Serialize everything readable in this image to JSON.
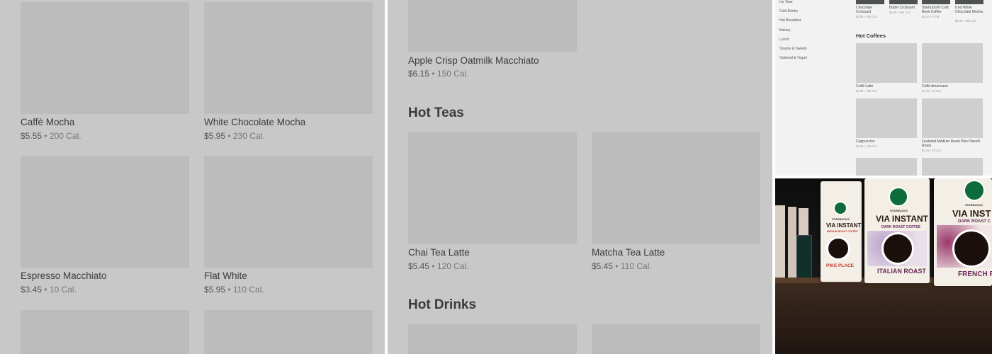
{
  "left_menu": {
    "items": [
      {
        "name": "Caffè Mocha",
        "price": "$5.55",
        "sep": " • ",
        "cal": "200 Cal."
      },
      {
        "name": "White Chocolate Mocha",
        "price": "$5.95",
        "sep": " • ",
        "cal": "230 Cal."
      },
      {
        "name": "Espresso Macchiato",
        "price": "$3.45",
        "sep": " • ",
        "cal": "10 Cal."
      },
      {
        "name": "Flat White",
        "price": "$5.95",
        "sep": " • ",
        "cal": "110 Cal."
      }
    ]
  },
  "middle_menu": {
    "top_item": {
      "name": "Apple Crisp Oatmilk Macchiato",
      "price": "$6.15",
      "sep": " • ",
      "cal": "150 Cal."
    },
    "hot_teas": {
      "title": "Hot Teas",
      "items": [
        {
          "name": "Chai Tea Latte",
          "price": "$5.45",
          "sep": " • ",
          "cal": "120 Cal."
        },
        {
          "name": "Matcha Tea Latte",
          "price": "$5.45",
          "sep": " • ",
          "cal": "110 Cal."
        }
      ]
    },
    "hot_drinks": {
      "title": "Hot Drinks"
    }
  },
  "mini_menu": {
    "nav": [
      "Ice Teas",
      "Cold Drinks",
      "Hot Breakfast",
      "Bakery",
      "Lunch",
      "Snacks & Sweets",
      "Oatmeal & Yogurt"
    ],
    "top_row": [
      {
        "name": "Chocolate Croissant",
        "meta": "$4.55 • 300 Cal."
      },
      {
        "name": "Butter Croissant",
        "meta": "$4.45 • 260 Cal."
      },
      {
        "name": "Starbucks® Cold Brew Coffee",
        "meta": "$5.15 • 5 Cal."
      },
      {
        "name": "Iced White Chocolate Mocha",
        "meta": "$6.35 • 390 Cal."
      }
    ],
    "hot_coffees": {
      "title": "Hot Coffees",
      "items": [
        {
          "name": "Caffè Latte",
          "meta": "$4.95 • 190 Cal."
        },
        {
          "name": "Caffè Americano",
          "meta": "$4.15 • 15 Cal."
        },
        {
          "name": "Cappuccino",
          "meta": "$4.95 • 140 Cal."
        },
        {
          "name": "Featured Medium Roast Pike Place® Roast",
          "meta": "$4.15 • 10 Cal."
        }
      ]
    }
  },
  "photo": {
    "bags": [
      {
        "brand": "STARBUCKS",
        "via": "VIA INSTANT",
        "roast": "MEDIUM ROAST COFFEE",
        "flavor": "PIKE PLACE"
      },
      {
        "brand": "STARBUCKS",
        "via": "VIA INSTANT",
        "roast": "DARK ROAST COFFEE",
        "flavor": "ITALIAN ROAST"
      },
      {
        "brand": "STARBUCKS",
        "via": "VIA INST",
        "roast": "DARK ROAST C",
        "flavor": "FRENCH RO"
      }
    ],
    "colors": {
      "medium_roast": "#c0392b",
      "dark_roast": "#6a2a5a",
      "logo_green": "#0d6b3c"
    }
  }
}
